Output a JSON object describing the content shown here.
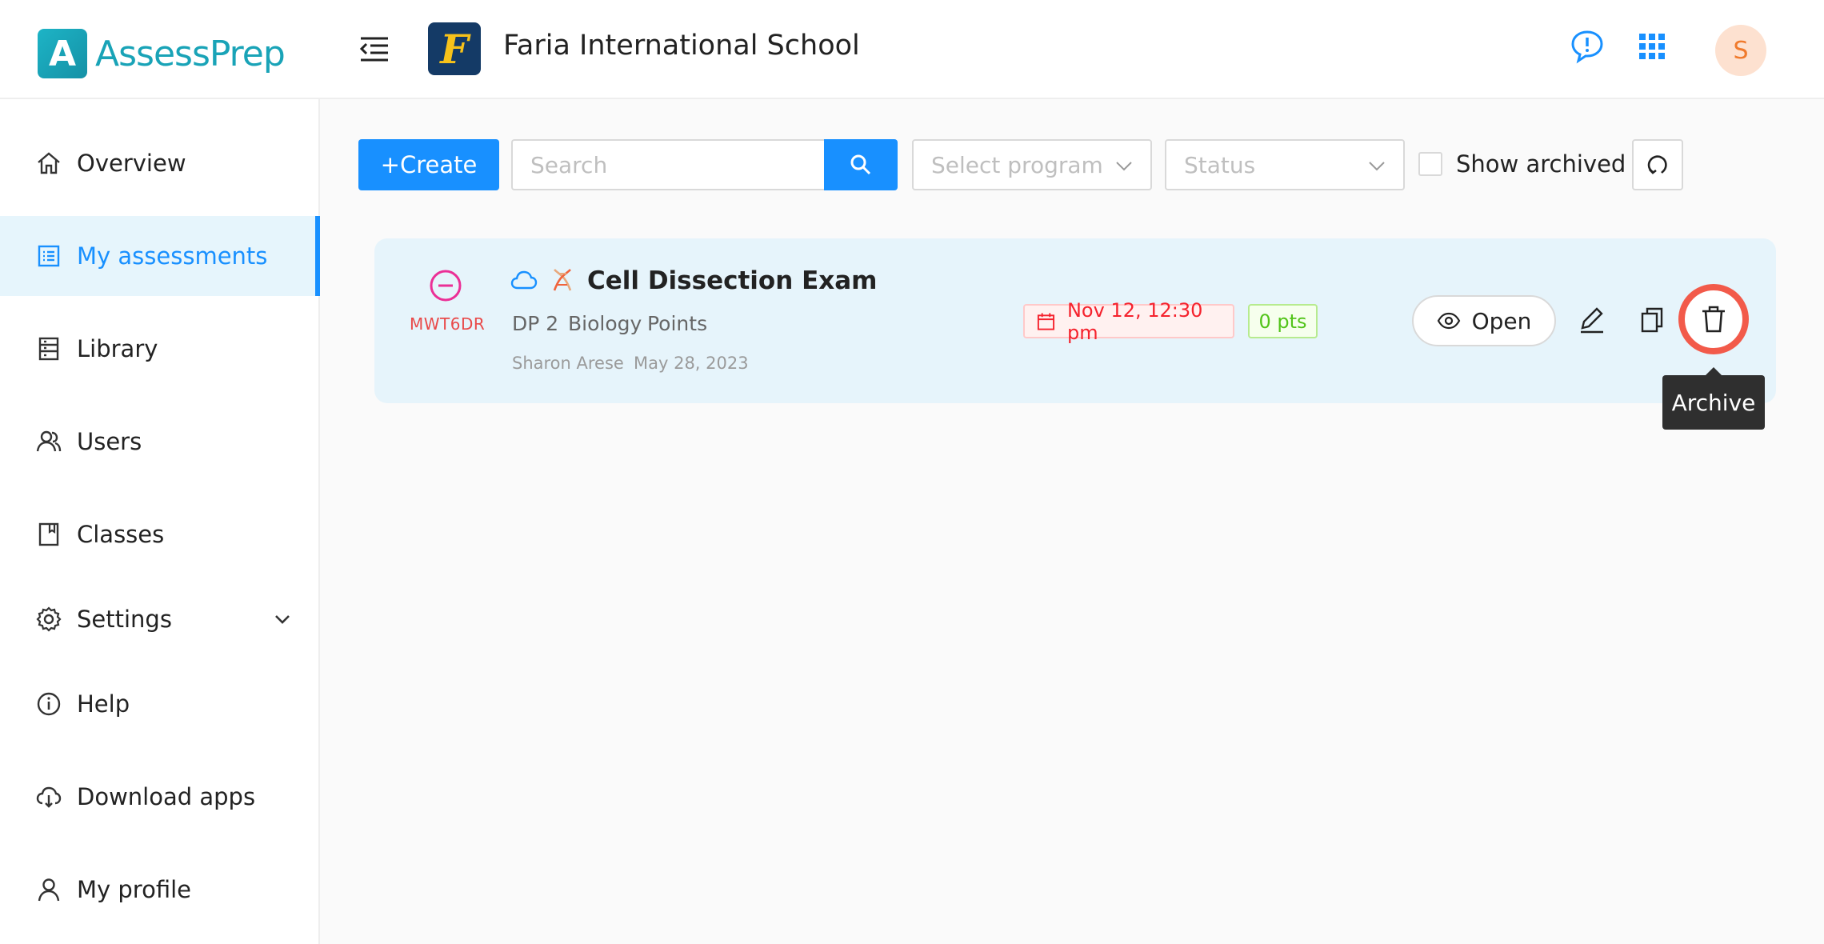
{
  "app": {
    "logo_letter": "A",
    "logo_text": "AssessPrep"
  },
  "header": {
    "school_logo_letter": "F",
    "school_name": "Faria International School",
    "avatar_initial": "S"
  },
  "sidebar": {
    "items": [
      {
        "label": "Overview",
        "icon": "home-icon"
      },
      {
        "label": "My assessments",
        "icon": "list-icon",
        "active": true
      },
      {
        "label": "Library",
        "icon": "library-icon"
      },
      {
        "label": "Users",
        "icon": "users-icon"
      },
      {
        "label": "Classes",
        "icon": "book-icon"
      },
      {
        "label": "Settings",
        "icon": "gear-icon"
      },
      {
        "label": "Help",
        "icon": "info-icon"
      },
      {
        "label": "Download apps",
        "icon": "cloud-download-icon"
      },
      {
        "label": "My profile",
        "icon": "user-icon"
      }
    ]
  },
  "toolbar": {
    "create_label": "+Create",
    "search_placeholder": "Search",
    "program_placeholder": "Select program",
    "status_placeholder": "Status",
    "show_archived_label": "Show archived"
  },
  "assessment": {
    "code": "MWT6DR",
    "title": "Cell Dissection Exam",
    "grade": "DP 2",
    "subject": "Biology",
    "grading": "Points",
    "author": "Sharon Arese",
    "created": "May 28, 2023",
    "due": "Nov 12, 12:30 pm",
    "points": "0 pts",
    "open_label": "Open",
    "tooltip": "Archive"
  },
  "colors": {
    "accent": "#1890ff",
    "brand": "#19a3b7",
    "highlight_ring": "#f25a4a"
  }
}
